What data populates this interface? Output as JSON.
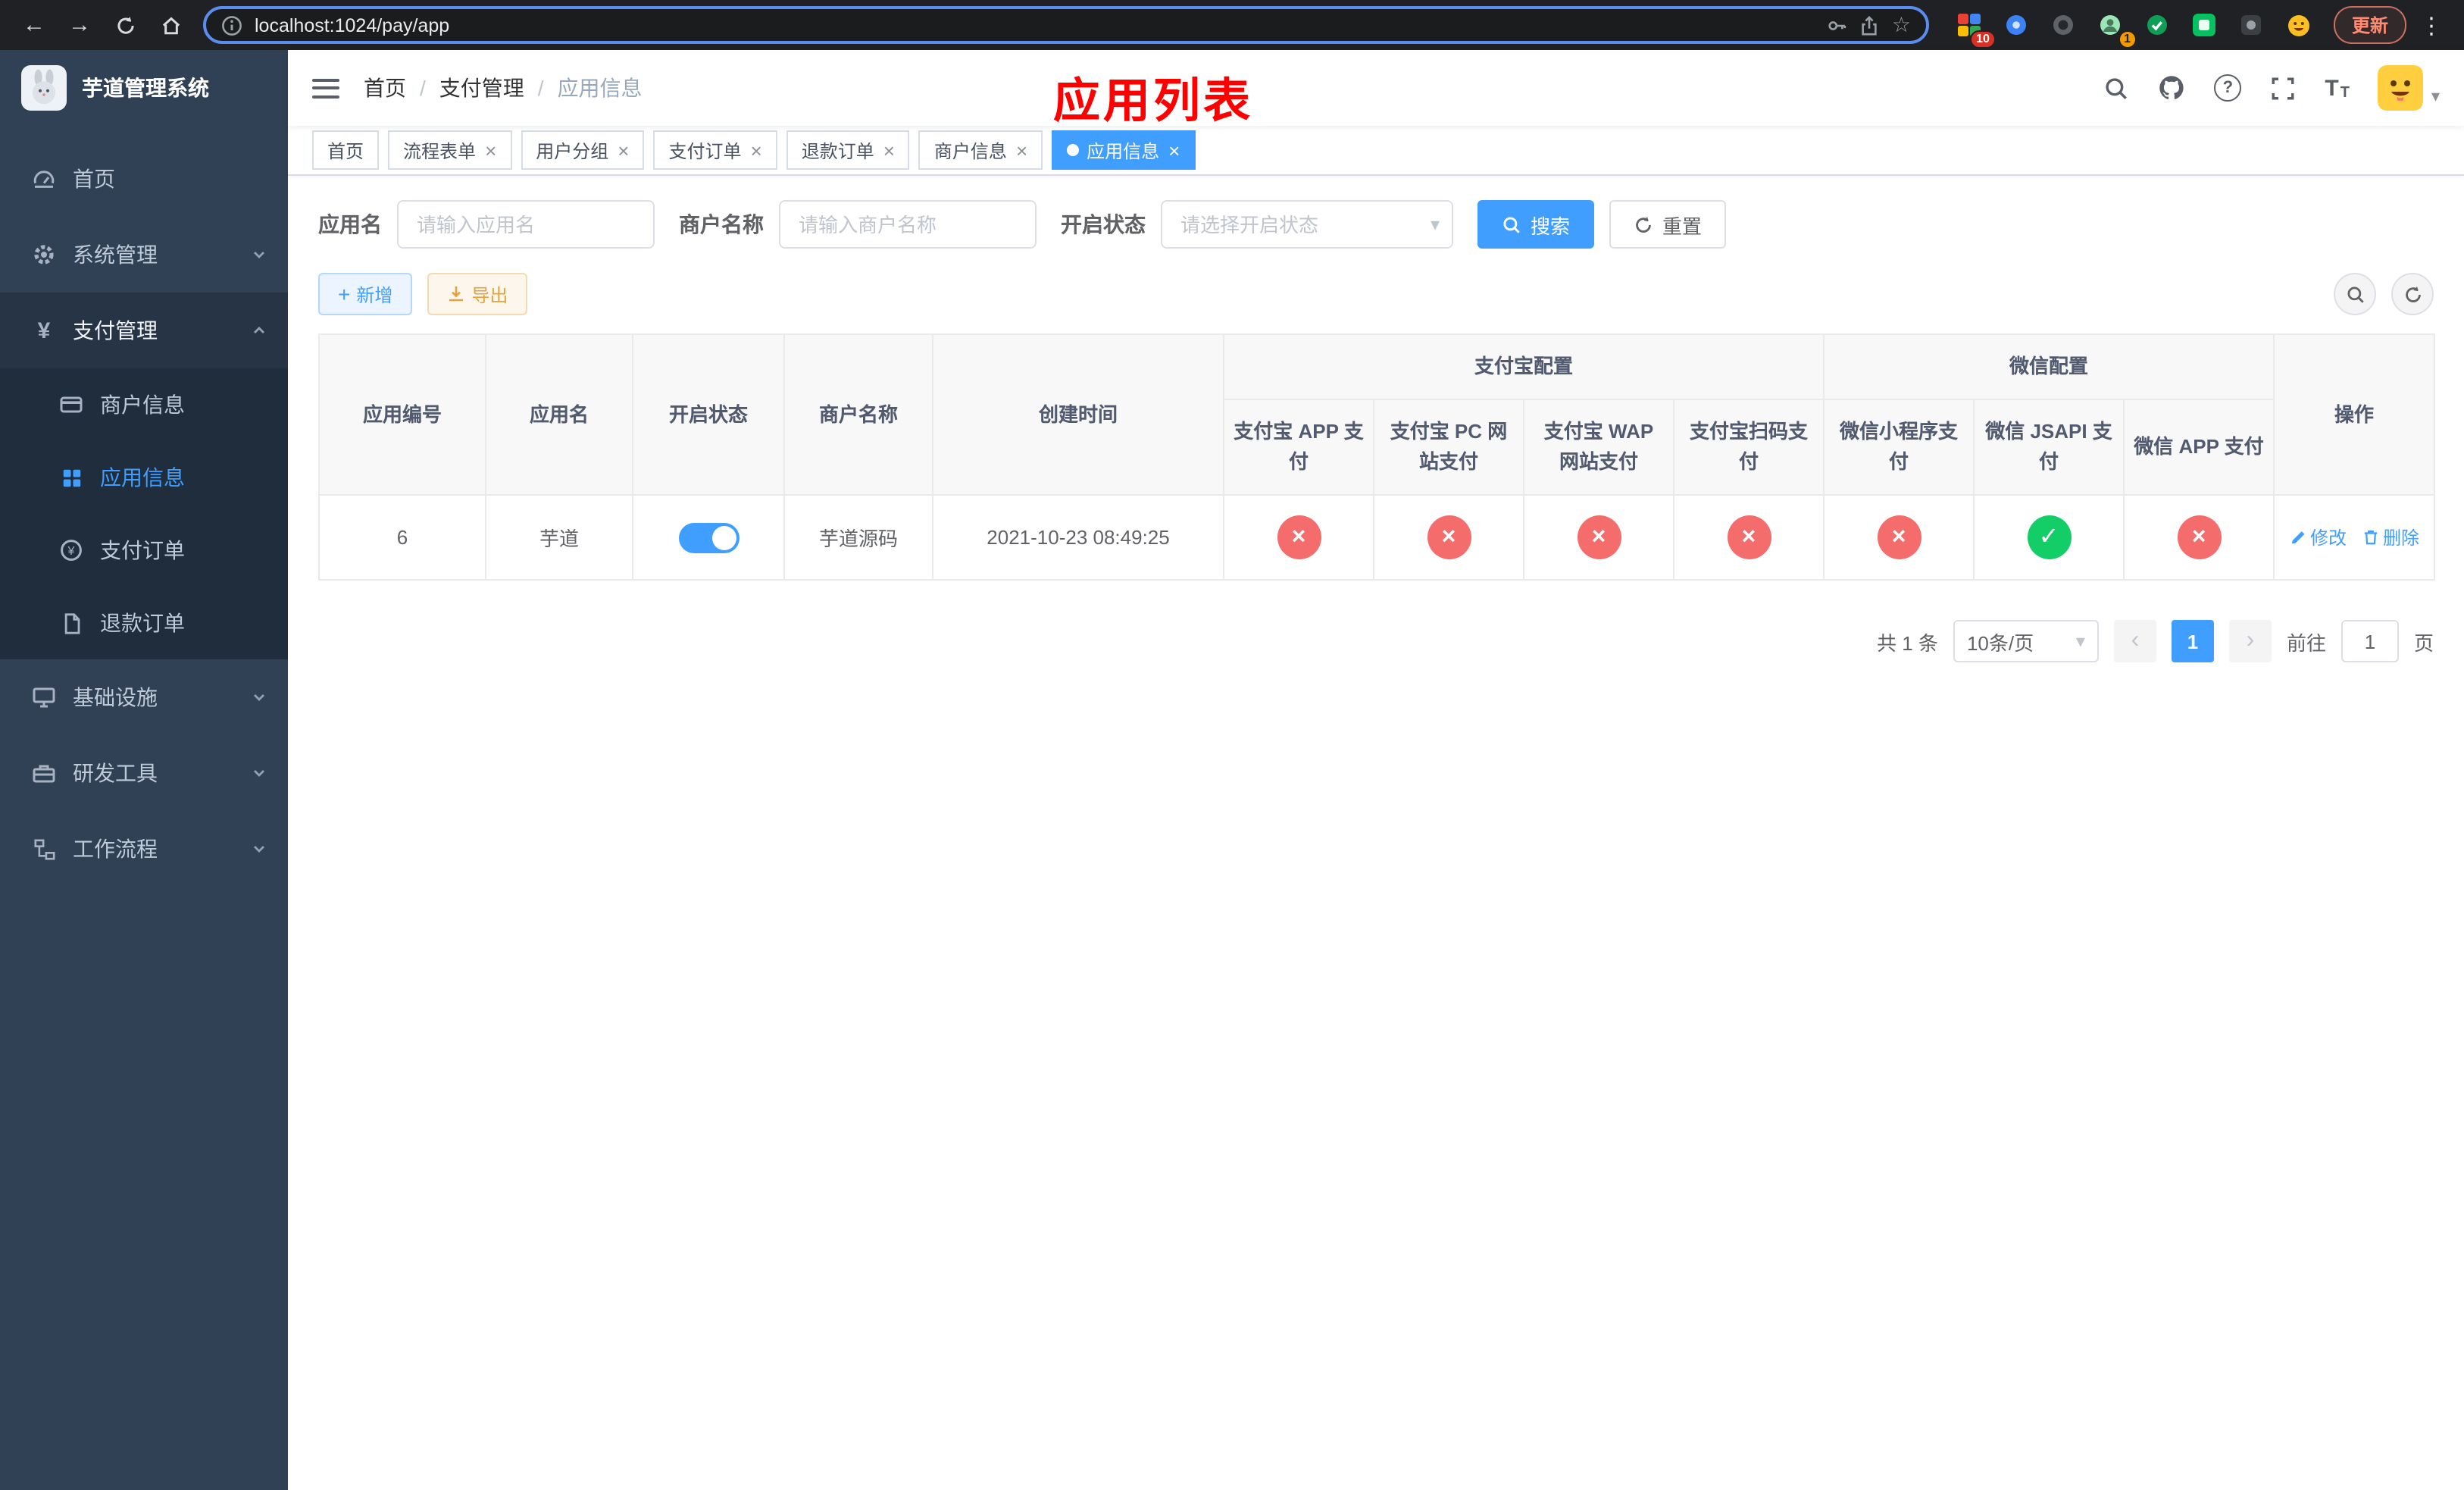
{
  "colors": {
    "primary": "#409eff",
    "success": "#13ce66",
    "danger": "#f56c6c",
    "warning": "#e6a23c",
    "annotation": "#ff0000",
    "sidebar_bg": "#304156",
    "sidebar_submenu_bg": "#1f2d3d"
  },
  "browser": {
    "url": "localhost:1024/pay/app",
    "update_label": "更新",
    "ext_badge_grid": "10",
    "ext_badge_avatar": "1"
  },
  "sidebar": {
    "title": "芋道管理系统",
    "home": "首页",
    "system": "系统管理",
    "payment": "支付管理",
    "merchant_info": "商户信息",
    "app_info": "应用信息",
    "pay_order": "支付订单",
    "refund_order": "退款订单",
    "infra": "基础设施",
    "dev_tools": "研发工具",
    "workflow": "工作流程"
  },
  "header": {
    "breadcrumb_home": "首页",
    "breadcrumb_section": "支付管理",
    "breadcrumb_current": "应用信息",
    "separator": "/",
    "overlay_title": "应用列表"
  },
  "tabs": [
    {
      "label": "首页"
    },
    {
      "label": "流程表单"
    },
    {
      "label": "用户分组"
    },
    {
      "label": "支付订单"
    },
    {
      "label": "退款订单"
    },
    {
      "label": "商户信息"
    },
    {
      "label": "应用信息"
    }
  ],
  "filters": {
    "app_name_label": "应用名",
    "app_name_placeholder": "请输入应用名",
    "merchant_label": "商户名称",
    "merchant_placeholder": "请输入商户名称",
    "status_label": "开启状态",
    "status_placeholder": "请选择开启状态",
    "search_label": "搜索",
    "reset_label": "重置"
  },
  "toolbar": {
    "add_label": "新增",
    "export_label": "导出"
  },
  "table": {
    "group_alipay": "支付宝配置",
    "group_wechat": "微信配置",
    "col_id": "应用编号",
    "col_name": "应用名",
    "col_status": "开启状态",
    "col_merchant": "商户名称",
    "col_created": "创建时间",
    "col_alipay_app": "支付宝 APP 支付",
    "col_alipay_pc": "支付宝 PC 网站支付",
    "col_alipay_wap": "支付宝 WAP 网站支付",
    "col_alipay_qr": "支付宝扫码支付",
    "col_wx_lite": "微信小程序支付",
    "col_wx_jsapi": "微信 JSAPI 支付",
    "col_wx_app": "微信 APP 支付",
    "col_actions": "操作",
    "row": {
      "id": "6",
      "name": "芋道",
      "enabled": true,
      "merchant": "芋道源码",
      "created": "2021-10-23 08:49:25",
      "alipay_app": false,
      "alipay_pc": false,
      "alipay_wap": false,
      "alipay_qr": false,
      "wx_lite": false,
      "wx_jsapi": true,
      "wx_app": false
    },
    "action_edit": "修改",
    "action_delete": "删除"
  },
  "pagination": {
    "total": "共 1 条",
    "page_size": "10条/页",
    "current_page": "1",
    "goto_label": "前往",
    "goto_value": "1",
    "page_unit": "页"
  },
  "icons": {
    "back": "←",
    "forward": "→",
    "star": "☆",
    "menu_dots": "⋮",
    "caret": "▾",
    "plus": "+",
    "yes": "✓",
    "no": "×",
    "prev": "‹",
    "next": "›",
    "yen": "¥",
    "question": "?"
  }
}
